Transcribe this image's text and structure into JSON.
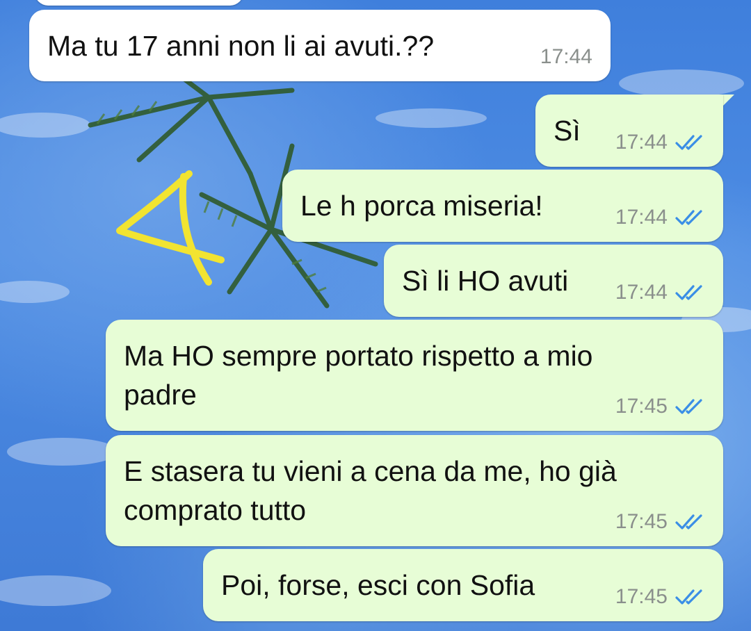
{
  "messages": [
    {
      "direction": "in",
      "text": "Ma tu 17 anni non li ai avuti.??",
      "time": "17:44",
      "ticks": false
    },
    {
      "direction": "out",
      "text": "Sì",
      "time": "17:44",
      "ticks": true
    },
    {
      "direction": "out",
      "text": "Le h porca miseria!",
      "time": "17:44",
      "ticks": true
    },
    {
      "direction": "out",
      "text": "Sì li HO avuti",
      "time": "17:44",
      "ticks": true
    },
    {
      "direction": "out",
      "text": "Ma HO sempre portato rispetto a mio\npadre",
      "time": "17:45",
      "ticks": true
    },
    {
      "direction": "out",
      "text": "E stasera tu vieni a cena da me, ho già\ncomprato tutto",
      "time": "17:45",
      "ticks": true
    },
    {
      "direction": "out",
      "text": "Poi, forse, esci con Sofia",
      "time": "17:45",
      "ticks": true
    }
  ],
  "annotation": {
    "text": "4",
    "color": "#f2e431"
  },
  "colors": {
    "incoming_bubble": "#ffffff",
    "outgoing_bubble": "#e7fdd6",
    "read_ticks": "#3a8ee6",
    "timestamp": "#8a8f8c"
  },
  "icons": {
    "read_receipt": "double-check-icon"
  }
}
